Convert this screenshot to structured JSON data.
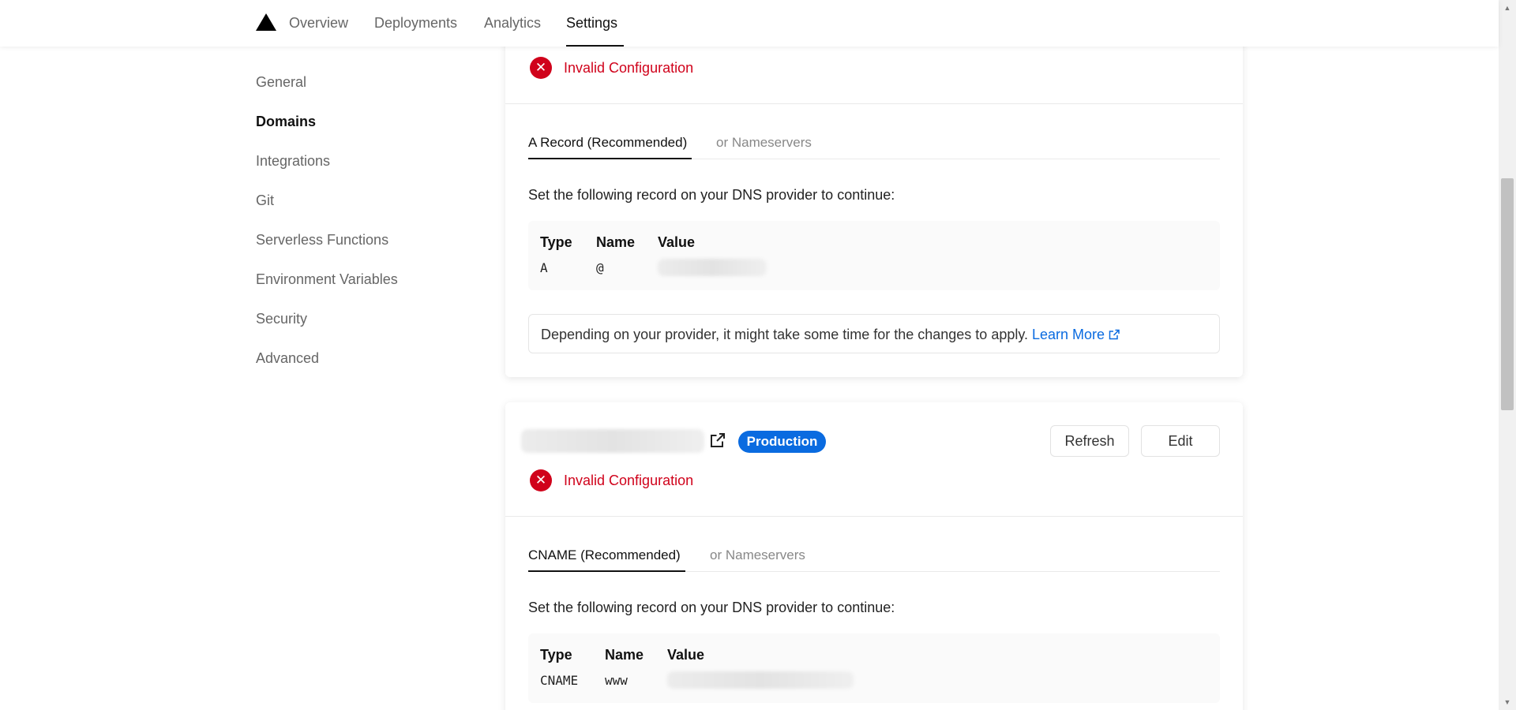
{
  "topnav": {
    "tabs": [
      {
        "label": "Overview"
      },
      {
        "label": "Deployments"
      },
      {
        "label": "Analytics"
      },
      {
        "label": "Settings"
      }
    ],
    "active_tab": "Settings"
  },
  "sidebar": {
    "items": [
      {
        "label": "General"
      },
      {
        "label": "Domains"
      },
      {
        "label": "Integrations"
      },
      {
        "label": "Git"
      },
      {
        "label": "Serverless Functions"
      },
      {
        "label": "Environment Variables"
      },
      {
        "label": "Security"
      },
      {
        "label": "Advanced"
      }
    ],
    "active_item": "Domains"
  },
  "domain_cards": [
    {
      "status": "Invalid Configuration",
      "tabs": [
        {
          "label": "A Record (Recommended)"
        },
        {
          "label": "or Nameservers"
        }
      ],
      "instructions": "Set the following record on your DNS provider to continue:",
      "record": {
        "headers": [
          "Type",
          "Name",
          "Value"
        ],
        "type": "A",
        "name": "@"
      },
      "notice": {
        "text": "Depending on your provider, it might take some time for the changes to apply. ",
        "link": "Learn More"
      }
    },
    {
      "badge": "Production",
      "buttons": {
        "refresh": "Refresh",
        "edit": "Edit"
      },
      "status": "Invalid Configuration",
      "tabs": [
        {
          "label": "CNAME (Recommended)"
        },
        {
          "label": "or Nameservers"
        }
      ],
      "instructions": "Set the following record on your DNS provider to continue:",
      "record": {
        "headers": [
          "Type",
          "Name",
          "Value"
        ],
        "type": "CNAME",
        "name": "www"
      }
    }
  ],
  "colors": {
    "error": "#d0021b",
    "link": "#0a6be0",
    "badge": "#0a6be0"
  }
}
